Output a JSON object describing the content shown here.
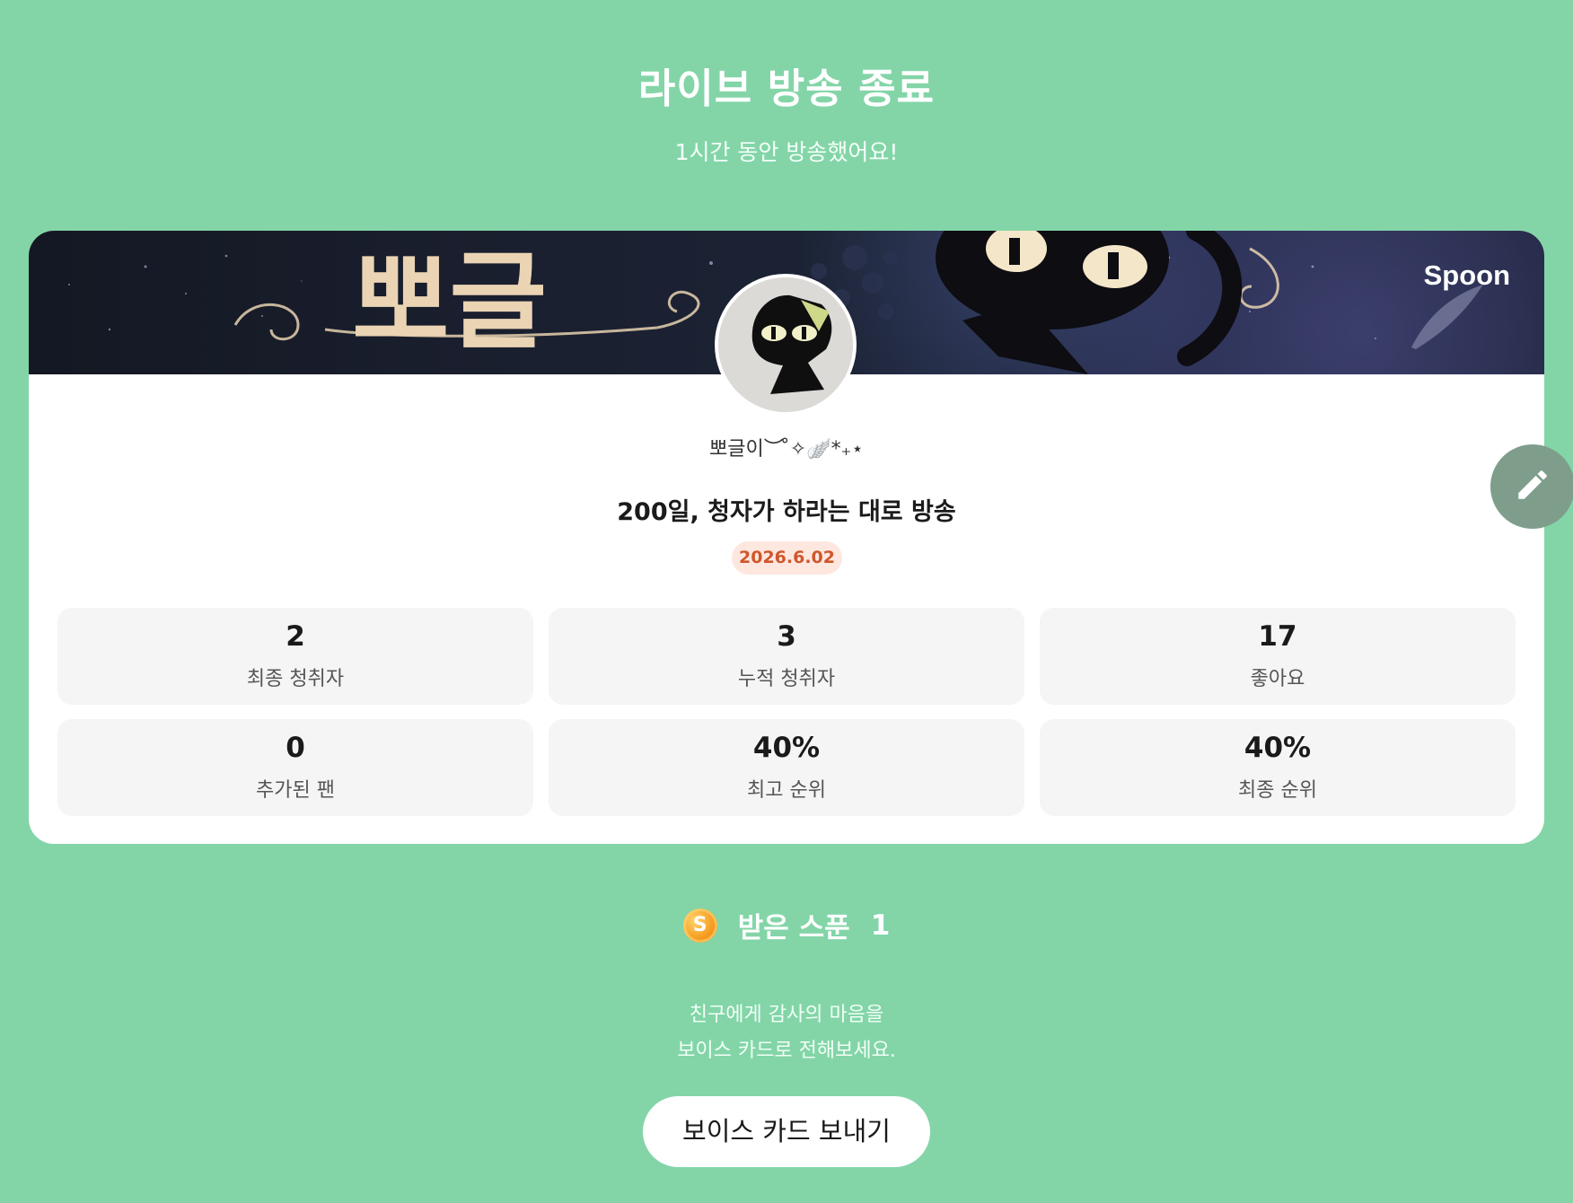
{
  "header": {
    "title": "라이브 방송 종료",
    "subtitle": "1시간 동안 방송했어요!"
  },
  "card": {
    "brand": "Spoon",
    "banner_text": "뽀글",
    "username": "뽀글이︶ ̊✧🪽*₊⋆",
    "broadcast_title": "200일, 청자가 하라는 대로 방송",
    "date": "2026.6.02",
    "stats": [
      {
        "value": "2",
        "label": "최종 청취자"
      },
      {
        "value": "3",
        "label": "누적 청취자"
      },
      {
        "value": "17",
        "label": "좋아요"
      },
      {
        "value": "0",
        "label": "추가된 팬"
      },
      {
        "value": "40%",
        "label": "최고 순위"
      },
      {
        "value": "40%",
        "label": "최종 순위"
      }
    ]
  },
  "spoons": {
    "icon": "spoon-coin-icon",
    "coin_letter": "S",
    "label": "받은 스푼",
    "count": "1"
  },
  "message": {
    "line1": "친구에게 감사의 마음을",
    "line2": "보이스 카드로 전해보세요."
  },
  "actions": {
    "voice_card_button": "보이스 카드 보내기",
    "edit_icon": "pencil-icon"
  },
  "colors": {
    "background": "#83d5a8",
    "badge_bg": "#fde7df",
    "badge_text": "#d0562c",
    "fab": "#7e9e8b"
  }
}
